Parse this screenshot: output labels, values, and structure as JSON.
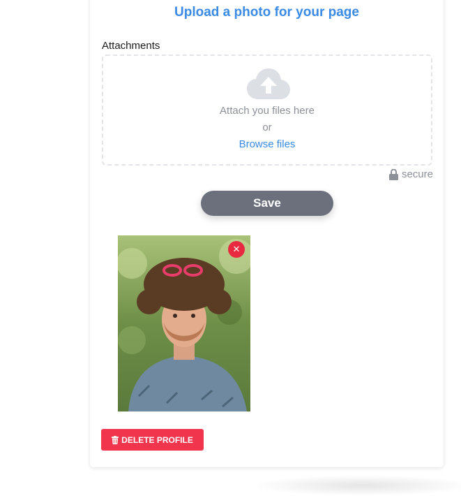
{
  "upload": {
    "title": "Upload a photo for your page",
    "attachments_label": "Attachments",
    "dropzone_text": "Attach you files here",
    "or_text": "or",
    "browse_label": "Browse files",
    "secure_label": "secure",
    "save_label": "Save"
  },
  "photo": {
    "remove_icon": "close-icon",
    "alt": "profile photo"
  },
  "profile": {
    "delete_label": "DELETE PROFILE",
    "delete_icon": "trash-icon"
  },
  "colors": {
    "accent": "#3a8ae6",
    "save_button": "#6b707c",
    "danger": "#f0354d"
  }
}
